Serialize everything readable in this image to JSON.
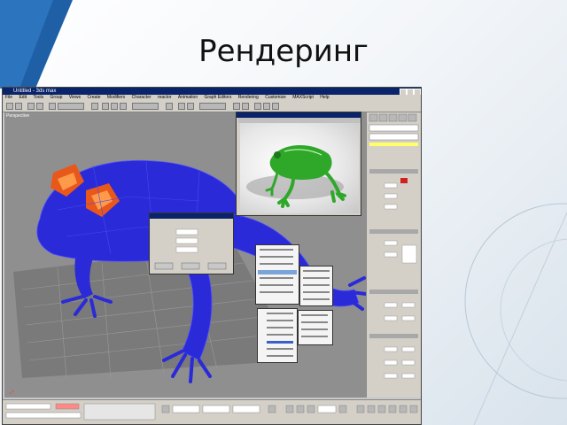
{
  "slide": {
    "title": "Рендеринг"
  },
  "app": {
    "title_partial": "Untitled - 3ds max",
    "menu": [
      "File",
      "Edit",
      "Tools",
      "Group",
      "Views",
      "Create",
      "Modifiers",
      "Character",
      "reactor",
      "Animation",
      "Graph Editors",
      "Rendering",
      "Customize",
      "MAXScript",
      "Help"
    ],
    "viewport_label": "Perspective"
  },
  "colors": {
    "frog_viewport": "#2a2ad8",
    "frog_render": "#2fa82a",
    "title_bar": "#0a246a",
    "panel_gray": "#d4d0c8"
  }
}
